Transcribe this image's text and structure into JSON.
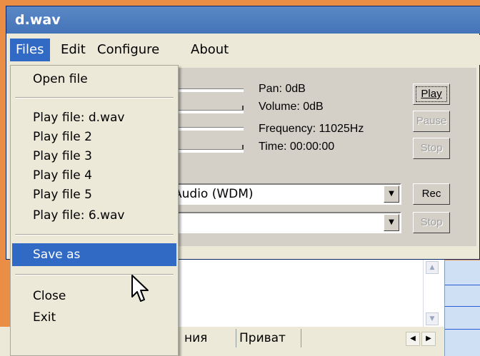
{
  "window": {
    "title": "d.wav"
  },
  "menubar": {
    "items": [
      "Files",
      "Edit",
      "Configure",
      "About"
    ]
  },
  "files_menu": {
    "open": "Open file",
    "recent": [
      "Play file: d.wav",
      "Play file 2",
      "Play file 3",
      "Play file 4",
      "Play file 5",
      "Play file: 6.wav"
    ],
    "save_as": "Save as",
    "close": "Close",
    "exit": "Exit"
  },
  "status": {
    "pan": "Pan: 0dB",
    "volume": "Volume: 0dB",
    "frequency": "Frequency: 11025Hz",
    "time": "Time: 00:00:00"
  },
  "buttons": {
    "play": "Play",
    "pause": "Pause",
    "stop": "Stop",
    "rec": "Rec",
    "stop_rec": "Stop"
  },
  "device_combo": {
    "value": "Audio (WDM)"
  },
  "second_combo": {
    "value": ""
  },
  "tabs": {
    "partial": "ния",
    "private": "Приват"
  },
  "colors": {
    "menu_highlight": "#316ac5",
    "titlebar": "#4a7ab9",
    "background": "#ea8e45"
  },
  "icons": {
    "combo_arrow": "chevron-down-icon",
    "cursor": "mouse-pointer-icon"
  }
}
